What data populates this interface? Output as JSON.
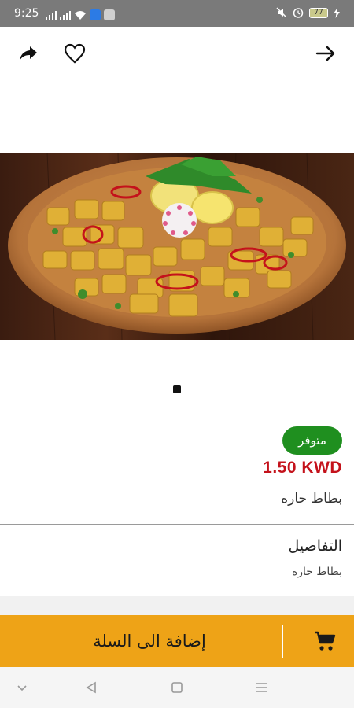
{
  "status_bar": {
    "time": "9:25",
    "battery": "77"
  },
  "toolbar": {
    "share_icon": "share-icon",
    "favorite_icon": "heart-icon",
    "back_icon": "arrow-right-icon"
  },
  "product": {
    "availability": "متوفر",
    "price": "1.50 KWD",
    "name": "بطاط حاره",
    "image_pages": 1,
    "current_page": 1
  },
  "details": {
    "title": "التفاصيل",
    "text": "بطاط حاره"
  },
  "cart": {
    "label": "إضافة الى السلة",
    "icon": "cart-icon"
  },
  "colors": {
    "accent": "#eea317",
    "price": "#c4121b",
    "badge": "#1f8f1f"
  }
}
